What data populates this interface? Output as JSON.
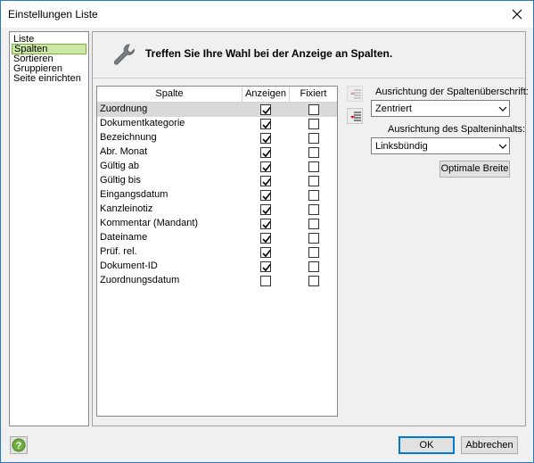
{
  "window": {
    "title": "Einstellungen Liste"
  },
  "nav": {
    "items": [
      {
        "label": "Liste",
        "selected": false
      },
      {
        "label": "Spalten",
        "selected": true
      },
      {
        "label": "Sortieren",
        "selected": false
      },
      {
        "label": "Gruppieren",
        "selected": false
      },
      {
        "label": "Seite einrichten",
        "selected": false
      }
    ]
  },
  "header": {
    "icon": "wrench-icon",
    "text": "Treffen Sie Ihre Wahl bei der Anzeige an Spalten."
  },
  "table": {
    "columns": [
      "Spalte",
      "Anzeigen",
      "Fixiert"
    ],
    "rows": [
      {
        "name": "Zuordnung",
        "show": true,
        "fixed": false,
        "selected": true
      },
      {
        "name": "Dokumentkategorie",
        "show": true,
        "fixed": false
      },
      {
        "name": "Bezeichnung",
        "show": true,
        "fixed": false
      },
      {
        "name": "Abr. Monat",
        "show": true,
        "fixed": false
      },
      {
        "name": "Gültig ab",
        "show": true,
        "fixed": false
      },
      {
        "name": "Gültig bis",
        "show": true,
        "fixed": false
      },
      {
        "name": "Eingangsdatum",
        "show": true,
        "fixed": false
      },
      {
        "name": "Kanzleinotiz",
        "show": true,
        "fixed": false
      },
      {
        "name": "Kommentar (Mandant)",
        "show": true,
        "fixed": false
      },
      {
        "name": "Dateiname",
        "show": true,
        "fixed": false
      },
      {
        "name": "Prüf. rel.",
        "show": true,
        "fixed": false
      },
      {
        "name": "Dokument-ID",
        "show": true,
        "fixed": false
      },
      {
        "name": "Zuordnungsdatum",
        "show": false,
        "fixed": false
      }
    ]
  },
  "options": {
    "header_align_label": "Ausrichtung der Spaltenüberschrift:",
    "header_align_value": "Zentriert",
    "content_align_label": "Ausrichtung des Spalteninhalts:",
    "content_align_value": "Linksbündig",
    "optimal_width_button": "Optimale Breite"
  },
  "footer": {
    "ok_button": "OK",
    "cancel_button": "Abbrechen"
  },
  "colors": {
    "selection_nav": "#cde8a5",
    "selection_row": "#d9d9d9",
    "accent": "#0078d7"
  }
}
